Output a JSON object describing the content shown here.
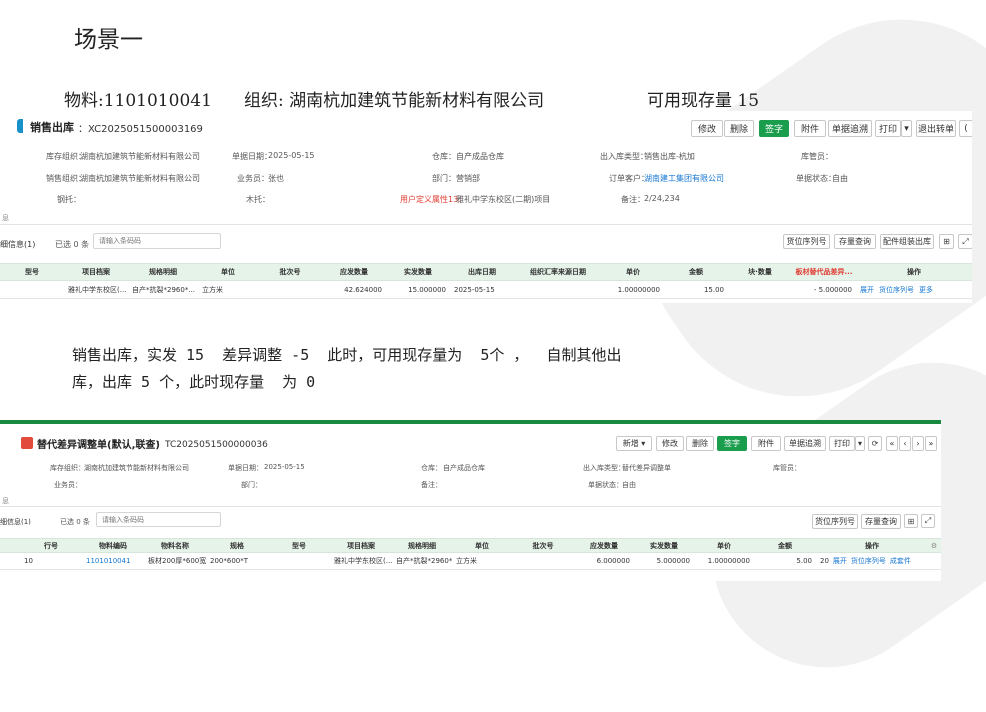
{
  "doc": {
    "scene_title": "场景一",
    "material_line": {
      "material": "物料:1101010041",
      "org": "组织: 湖南杭加建筑节能新材料有限公司",
      "avail": "可用现存量  15"
    },
    "note_line1": "销售出库，实发 15  差异调整 -5  此时，可用现存量为  5个 ，  自制其他出",
    "note_line2": "库，出库 5 个，此时现存量  为 0"
  },
  "shot1": {
    "title": "销售出库",
    "doc_no": "：XC2025051500003169",
    "buttons": [
      "修改",
      "删除",
      "签字",
      "附件",
      "单据追溯",
      "打印",
      "退出转单"
    ],
    "fields": {
      "row1": {
        "org_label": "库存组织：",
        "org_value": "湖南杭加建筑节能新材料有限公司",
        "date_label": "单据日期：",
        "date_value": "2025-05-15",
        "wh_label": "仓库：",
        "wh_value": "自产成品仓库",
        "type_label": "出入库类型：",
        "type_value": "销售出库-杭加",
        "keeper_label": "库管员："
      },
      "row2": {
        "sorg_label": "销售组织：",
        "sorg_value": "湖南杭加建筑节能新材料有限公司",
        "clerk_label": "业务员：",
        "clerk_value": "张也",
        "dept_label": "部门：",
        "dept_value": "营销部",
        "cust_label": "订单客户：",
        "cust_value": "湖南建工集团有限公司",
        "status_label": "单据状态：",
        "status_value": "自由"
      },
      "row3": {
        "pallet_label": "钢托：",
        "wood_label": "木托：",
        "custom_label": "用户定义属性13：",
        "custom_value": "雅礼中学东校区(二期)项目",
        "remark_label": "备注：",
        "remark_value": "2/24,234"
      }
    },
    "section_label": "息",
    "detail_label": "细信息(1)",
    "selected": "已选 0 条",
    "search_placeholder": "请输入条码码",
    "right_buttons": [
      "货位序列号",
      "存量查询",
      "配件组装出库"
    ],
    "grid_icon": "⊞",
    "expand_icon": "⤢",
    "columns": [
      "型号",
      "项目档案",
      "规格明细",
      "单位",
      "批次号",
      "应发数量",
      "实发数量",
      "出库日期",
      "组织汇率来源日期",
      "单价",
      "金额",
      "块·数量",
      "板材替代品差异...",
      "操作"
    ],
    "row": {
      "project": "雅礼中学东校区(...",
      "spec": "自产*抗裂*2960*...",
      "unit": "立方米",
      "should_qty": "42.624000",
      "actual_qty": "15.000000",
      "out_date": "2025-05-15",
      "price": "1.00000000",
      "amount": "15.00",
      "diff": "- 5.000000",
      "ops": [
        "展开",
        "货位序列号",
        "更多"
      ]
    }
  },
  "shot2": {
    "title": "替代差异调整单(默认,联查)",
    "doc_no": "：TC2025051500000036",
    "buttons": [
      "新增",
      "修改",
      "删除",
      "签字",
      "附件",
      "单据追溯",
      "打印"
    ],
    "nav_icons": [
      "⟳",
      "«",
      "‹",
      "›",
      "»"
    ],
    "fields": {
      "row1": {
        "org_label": "库存组织：",
        "org_value": "湖南杭加建筑节能新材料有限公司",
        "date_label": "单据日期：",
        "date_value": "2025-05-15",
        "wh_label": "仓库：",
        "wh_value": "自产成品仓库",
        "type_label": "出入库类型：",
        "type_value": "替代差异调整单",
        "keeper_label": "库管员："
      },
      "row2": {
        "clerk_label": "业务员：",
        "dept_label": "部门：",
        "remark_label": "备注：",
        "status_label": "单据状态：",
        "status_value": "自由"
      }
    },
    "section_label": "息",
    "detail_label": "细信息(1)",
    "selected": "已选 0 条",
    "search_placeholder": "请输入条码码",
    "right_buttons": [
      "货位序列号",
      "存量查询"
    ],
    "grid_icon": "⊞",
    "expand_icon": "⤢",
    "columns": [
      "行号",
      "物料编码",
      "物料名称",
      "规格",
      "型号",
      "项目档案",
      "规格明细",
      "单位",
      "批次号",
      "应发数量",
      "实发数量",
      "单价",
      "金额",
      "操作"
    ],
    "row": {
      "line": "10",
      "code": "1101010041",
      "name": "板材200厚*600宽...",
      "spec": "200*600*T",
      "project": "雅礼中学东校区(...",
      "spec_detail": "自产*抗裂*2960*...",
      "unit": "立方米",
      "should_qty": "6.000000",
      "actual_qty": "5.000000",
      "price": "1.00000000",
      "amount": "5.00",
      "extra": "20",
      "ops": [
        "展开",
        "货位序列号",
        "成套件"
      ]
    }
  },
  "colors": {
    "accent": "#1a9d4c",
    "grid_head": "#e6f3e9",
    "link": "#1677d2",
    "red": "#e03c31"
  }
}
